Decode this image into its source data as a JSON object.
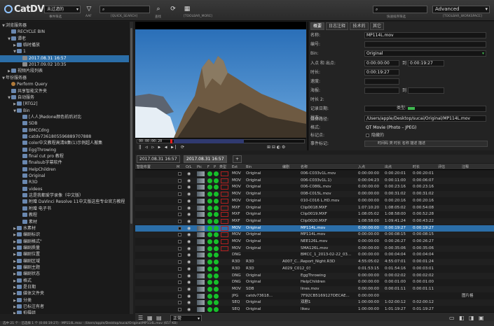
{
  "app": {
    "logo_text": "CatDV"
  },
  "toolbar": {
    "catalog_select": "未过滤的",
    "catalog_caption": "事件筛选",
    "filter_caption": "AAF",
    "quick_search_value": "[QUICK_SEARCH]",
    "search_caption": "查找",
    "toolbar_more_value": "[TOOLBAR_MORE]",
    "right_search_caption": "快速排序筛选",
    "advanced_select": "Advanced",
    "workspace_caption": "[TOOLBAR_WORKSPACE]"
  },
  "tree": [
    {
      "label": "浏览服务器",
      "depth": 0,
      "twisty": "▼",
      "icon": ""
    },
    {
      "label": "RECYCLE BIN",
      "depth": 1,
      "twisty": "",
      "icon": "fold"
    },
    {
      "label": "谭老",
      "depth": 1,
      "twisty": "▼",
      "icon": "fold"
    },
    {
      "label": "临时播放",
      "depth": 2,
      "twisty": "▶",
      "icon": "fold"
    },
    {
      "label": "1",
      "depth": 2,
      "twisty": "▼",
      "icon": "fold"
    },
    {
      "label": "2017.08.31 16:57",
      "depth": 3,
      "twisty": "",
      "icon": "clip",
      "selected": true
    },
    {
      "label": "2017.09.02 10:35",
      "depth": 3,
      "twisty": "",
      "icon": "clip"
    },
    {
      "label": "视频片段列表",
      "depth": 1,
      "twisty": "▶",
      "icon": "fold"
    },
    {
      "label": "年份服务器",
      "depth": 0,
      "twisty": "▼",
      "icon": ""
    },
    {
      "label": "Perform Query",
      "depth": 1,
      "twisty": "",
      "icon": "q"
    },
    {
      "label": "共享智能文件夹",
      "depth": 1,
      "twisty": "",
      "icon": "fold"
    },
    {
      "label": "自动服务",
      "depth": 1,
      "twisty": "▼",
      "icon": "fold"
    },
    {
      "label": "[RTG2]",
      "depth": 2,
      "twisty": "▶",
      "icon": "fold"
    },
    {
      "label": "Bin",
      "depth": 2,
      "twisty": "▼",
      "icon": "fold"
    },
    {
      "label": "[人人]Redone颜色前后对比",
      "depth": 3,
      "twisty": "",
      "icon": "fold"
    },
    {
      "label": "SDB",
      "depth": 3,
      "twisty": "",
      "icon": "fold"
    },
    {
      "label": "BMCCdng",
      "depth": 3,
      "twisty": "",
      "icon": "fold"
    },
    {
      "label": "catdv7361805596889707888",
      "depth": 3,
      "twisty": "",
      "icon": "fold"
    },
    {
      "label": "color中文教程高清8集(1)示例超人搬集",
      "depth": 3,
      "twisty": "",
      "icon": "fold"
    },
    {
      "label": "EggThrowing",
      "depth": 3,
      "twisty": "",
      "icon": "fold"
    },
    {
      "label": "final cut pro 教程",
      "depth": 3,
      "twisty": "",
      "icon": "fold"
    },
    {
      "label": "finalsub字幕软件",
      "depth": 3,
      "twisty": "",
      "icon": "fold"
    },
    {
      "label": "HelpChildren",
      "depth": 3,
      "twisty": "",
      "icon": "fold"
    },
    {
      "label": "Original",
      "depth": 3,
      "twisty": "",
      "icon": "fold"
    },
    {
      "label": "R3D",
      "depth": 3,
      "twisty": "",
      "icon": "fold"
    },
    {
      "label": "videos",
      "depth": 3,
      "twisty": "",
      "icon": "fold"
    },
    {
      "label": "这是我都爱学录像（中文版）",
      "depth": 3,
      "twisty": "",
      "icon": "fold"
    },
    {
      "label": "附赠 DaVinci Resolve 11中文版这些专业官方教程",
      "depth": 3,
      "twisty": "",
      "icon": "fold"
    },
    {
      "label": "附赠 电子书",
      "depth": 3,
      "twisty": "",
      "icon": "fold"
    },
    {
      "label": "教程",
      "depth": 3,
      "twisty": "",
      "icon": "fold"
    },
    {
      "label": "素材",
      "depth": 3,
      "twisty": "",
      "icon": "fold"
    },
    {
      "label": "水素材",
      "depth": 2,
      "twisty": "▶",
      "icon": "fold"
    },
    {
      "label": "编剧标识",
      "depth": 2,
      "twisty": "▶",
      "icon": "fold"
    },
    {
      "label": "编剧格式\"",
      "depth": 2,
      "twisty": "▶",
      "icon": "fold"
    },
    {
      "label": "编剧质量",
      "depth": 2,
      "twisty": "▶",
      "icon": "fold"
    },
    {
      "label": "编剧位置",
      "depth": 2,
      "twisty": "▶",
      "icon": "fold"
    },
    {
      "label": "编剧区域",
      "depth": 2,
      "twisty": "▶",
      "icon": "fold"
    },
    {
      "label": "编剧主题",
      "depth": 2,
      "twisty": "▶",
      "icon": "fold"
    },
    {
      "label": "编剧状态",
      "depth": 2,
      "twisty": "▶",
      "icon": "fold"
    },
    {
      "label": "格式",
      "depth": 2,
      "twisty": "▶",
      "icon": "fold"
    },
    {
      "label": "是日期",
      "depth": 2,
      "twisty": "▶",
      "icon": "fold"
    },
    {
      "label": "媒体文件夹",
      "depth": 2,
      "twisty": "▶",
      "icon": "fold"
    },
    {
      "label": "分类",
      "depth": 2,
      "twisty": "▶",
      "icon": "fold"
    },
    {
      "label": "已标注有者",
      "depth": 2,
      "twisty": "▶",
      "icon": "fold"
    },
    {
      "label": "拍摄组",
      "depth": 2,
      "twisty": "▶",
      "icon": "fold"
    },
    {
      "label": "分组",
      "depth": 2,
      "twisty": "▶",
      "icon": "fold"
    },
    {
      "label": "拍摄者",
      "depth": 2,
      "twisty": "▶",
      "icon": "fold"
    }
  ],
  "viewer": {
    "timecode_in": "00:00:00:20",
    "controls": "‖ ◁ ▷ ▶ ◀ ▶| ⟳"
  },
  "inspector": {
    "tabs": [
      "概要",
      "日志注释",
      "技术的",
      "其它"
    ],
    "fields": {
      "name_label": "名称:",
      "name_value": "MP114L.mov",
      "code_label": "编号:",
      "bin_label": "Bin:",
      "bin_value": "Original",
      "in_label": "入点 和 出点:",
      "in_value": "0:00:00:00",
      "out_prefix": "到",
      "out_value": "0:00:19:27",
      "duration_label": "时长:",
      "duration_value": "0:00:19:27",
      "speed_label": "速度:",
      "poster_label": "海报:",
      "poster_to": "到",
      "time2_label": "时长 2:",
      "notes_label": "记录日期:",
      "status_label": "状态:",
      "type_label": "类型:",
      "media_path_label": "媒体路径:",
      "media_path_value": "/Users/apple/Desktop/sucai/Original/MP114L.mov",
      "format_label": "格式:",
      "format_value": "QT Movie (Photo – JPEG)",
      "marks_label": "标记点:",
      "hidden_label": "隐藏的",
      "events_label": "事件标记:",
      "events_cols": "时间码         类         时长     名称  描述 描述"
    }
  },
  "clip_tabs": [
    "2017.08.31 16:57",
    "2017.08.31 16:57",
    "+"
  ],
  "table": {
    "headers": [
      "智能布置",
      "M",
      "O/L",
      "Pic",
      "F",
      "P",
      "类型",
      "Ext",
      "Bin",
      "编剧",
      "名称",
      "入点",
      "出点",
      "时长",
      "评估",
      "注释"
    ],
    "rows": [
      {
        "ext": "MOV",
        "bin": "Original",
        "edit": "",
        "name": "006-C033v1L.mov",
        "in": "0:00:00:00",
        "out": "0:00:20:01",
        "dur": "0:00:20:01",
        "note": "",
        "red": true
      },
      {
        "ext": "MOV",
        "bin": "Original",
        "edit": "",
        "name": "006-C033v1L.1)",
        "in": "0:00:04:23",
        "out": "0:00:11:00",
        "dur": "0:00:06:07",
        "note": "",
        "red": true
      },
      {
        "ext": "MOV",
        "bin": "Original",
        "edit": "",
        "name": "006-C086L.mov",
        "in": "0:00:00:00",
        "out": "0:00:23:16",
        "dur": "0:00:23:16",
        "note": "",
        "red": true
      },
      {
        "ext": "MOV",
        "bin": "Original",
        "edit": "",
        "name": "008-C015L.mov",
        "in": "0:00:00:00",
        "out": "0:00:31:02",
        "dur": "0:00:31:02",
        "note": "",
        "red": true
      },
      {
        "ext": "MOV",
        "bin": "Original",
        "edit": "",
        "name": "010-C016 L.HD.mov",
        "in": "0:00:00:00",
        "out": "0:00:20:16",
        "dur": "0:00:20:16",
        "note": "",
        "red": true
      },
      {
        "ext": "MXF",
        "bin": "Original",
        "edit": "",
        "name": "Clip0018.MXF",
        "in": "1:07:10:20",
        "out": "1:08:05:02",
        "dur": "0:00:54:08",
        "note": "",
        "red": true
      },
      {
        "ext": "MXF",
        "bin": "Original",
        "edit": "",
        "name": "Clip0019.MXF",
        "in": "1:08:05:02",
        "out": "1:08:58:00",
        "dur": "0:00:52:28",
        "note": "",
        "red": true
      },
      {
        "ext": "MXF",
        "bin": "Original",
        "edit": "",
        "name": "Clip0020.MXF",
        "in": "1:08:58:00",
        "out": "1:09:41:24",
        "dur": "0:00:43:22",
        "note": "",
        "red": true
      },
      {
        "ext": "MOV",
        "bin": "Original",
        "edit": "",
        "name": "MP114L.mov",
        "in": "0:00:00:00",
        "out": "0:00:19:27",
        "dur": "0:00:19:27",
        "note": "",
        "red": true,
        "selected": true
      },
      {
        "ext": "MOV",
        "bin": "Original",
        "edit": "",
        "name": "MP114L.mov",
        "in": "0:00:00:00",
        "out": "0:00:08:15",
        "dur": "0:00:08:15",
        "note": "",
        "red": true
      },
      {
        "ext": "MOV",
        "bin": "Original",
        "edit": "",
        "name": "NEE126L.mov",
        "in": "0:00:00:00",
        "out": "0:00:26:27",
        "dur": "0:00:26:27",
        "note": "",
        "red": true
      },
      {
        "ext": "MOV",
        "bin": "Original",
        "edit": "",
        "name": "SMA126L.mov",
        "in": "0:00:00:00",
        "out": "0:00:35:06",
        "dur": "0:00:35:06",
        "note": "",
        "red": true
      },
      {
        "ext": "DNG",
        "bin": "",
        "edit": "",
        "name": "BMCC_1_2013-02-22_03...",
        "in": "0:00:00:00",
        "out": "0:00:04:04",
        "dur": "0:00:04:04",
        "note": "",
        "red": false
      },
      {
        "ext": "R3D",
        "bin": "R3D",
        "edit": "A007_C...",
        "name": "Report_Night.R3D",
        "in": "4:55:05:02",
        "out": "4:55:07:01",
        "dur": "0:00:01:24",
        "note": "",
        "red": false
      },
      {
        "ext": "R3D",
        "bin": "R3D",
        "edit": "A029_C012_0315ZT_001...",
        "name": "",
        "in": "0:01:53:15",
        "out": "0:01:54:16",
        "dur": "0:00:03:01",
        "note": "",
        "red": false
      },
      {
        "ext": "DNG",
        "bin": "Original",
        "edit": "",
        "name": "EggThrowing",
        "in": "0:00:00:00",
        "out": "0:00:02:02",
        "dur": "0:00:02:02",
        "note": "",
        "red": false
      },
      {
        "ext": "DNG",
        "bin": "Original",
        "edit": "",
        "name": "HelpChildren",
        "in": "0:00:00:00",
        "out": "0:00:01:00",
        "dur": "0:00:01:00",
        "note": "",
        "red": false
      },
      {
        "ext": "MOV",
        "bin": "SDB",
        "edit": "",
        "name": "lines.mov",
        "in": "0:00:00:00",
        "out": "0:00:01:11",
        "dur": "0:00:01:11",
        "note": "",
        "red": false
      },
      {
        "ext": "JPG",
        "bin": "catdv73618...",
        "edit": "",
        "name": "7F92CB5169127DECAE...",
        "in": "0:00:00:00",
        "out": "",
        "dur": "",
        "note": "图片格",
        "red": false
      },
      {
        "ext": "SEQ",
        "bin": "Original",
        "edit": "",
        "name": "双剧1",
        "in": "1:00:00:00",
        "out": "1:02:00:12",
        "dur": "0:02:00:12",
        "note": "",
        "red": false
      },
      {
        "ext": "SEQ",
        "bin": "Original",
        "edit": "",
        "name": "likeu",
        "in": "1:00:00:00",
        "out": "1:01:19:27",
        "dur": "0:01:19:27",
        "note": "",
        "red": false
      }
    ]
  },
  "bottom_bar": {
    "view_select": "正常"
  },
  "status": {
    "text": "选中 21 个 · 已选择 1 个 (0:00:19:27) · MP114L.mov · /Users/apple/Desktop/sucai/Original/MP114L.mov (657 KB)"
  }
}
